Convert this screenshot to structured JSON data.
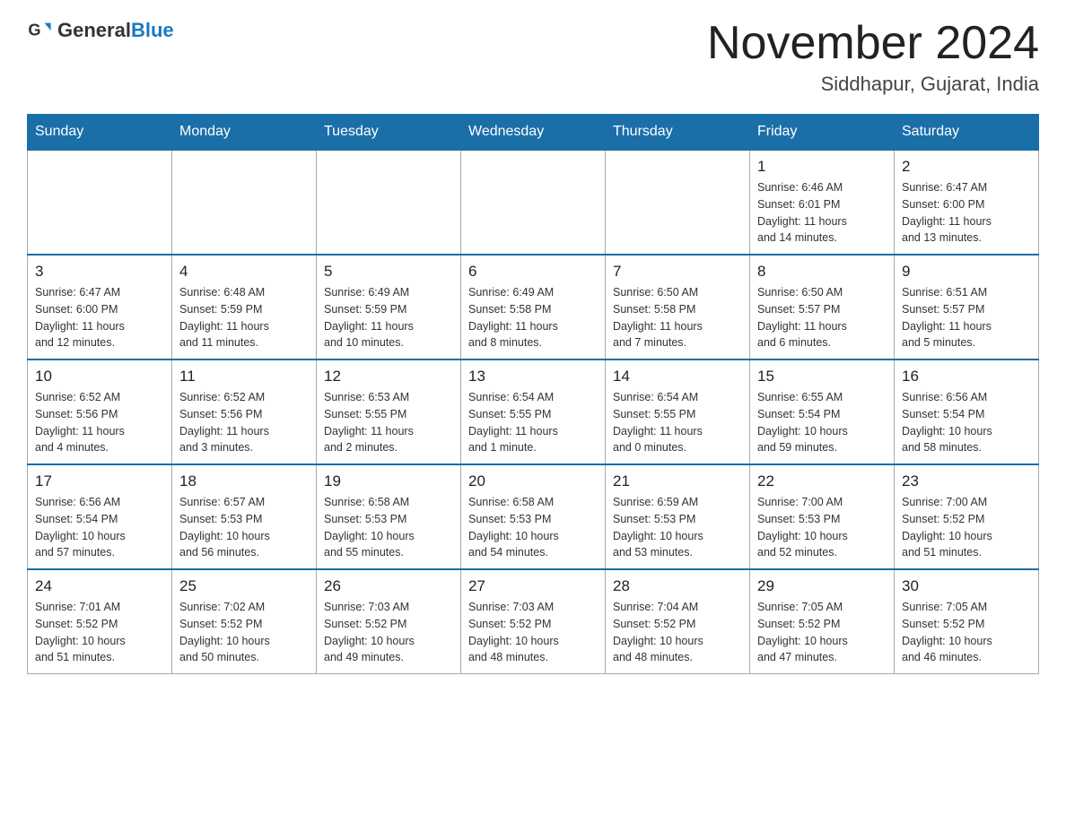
{
  "logo": {
    "general": "General",
    "blue": "Blue"
  },
  "header": {
    "month": "November 2024",
    "location": "Siddhapur, Gujarat, India"
  },
  "weekdays": [
    "Sunday",
    "Monday",
    "Tuesday",
    "Wednesday",
    "Thursday",
    "Friday",
    "Saturday"
  ],
  "weeks": [
    [
      {
        "day": "",
        "info": ""
      },
      {
        "day": "",
        "info": ""
      },
      {
        "day": "",
        "info": ""
      },
      {
        "day": "",
        "info": ""
      },
      {
        "day": "",
        "info": ""
      },
      {
        "day": "1",
        "info": "Sunrise: 6:46 AM\nSunset: 6:01 PM\nDaylight: 11 hours\nand 14 minutes."
      },
      {
        "day": "2",
        "info": "Sunrise: 6:47 AM\nSunset: 6:00 PM\nDaylight: 11 hours\nand 13 minutes."
      }
    ],
    [
      {
        "day": "3",
        "info": "Sunrise: 6:47 AM\nSunset: 6:00 PM\nDaylight: 11 hours\nand 12 minutes."
      },
      {
        "day": "4",
        "info": "Sunrise: 6:48 AM\nSunset: 5:59 PM\nDaylight: 11 hours\nand 11 minutes."
      },
      {
        "day": "5",
        "info": "Sunrise: 6:49 AM\nSunset: 5:59 PM\nDaylight: 11 hours\nand 10 minutes."
      },
      {
        "day": "6",
        "info": "Sunrise: 6:49 AM\nSunset: 5:58 PM\nDaylight: 11 hours\nand 8 minutes."
      },
      {
        "day": "7",
        "info": "Sunrise: 6:50 AM\nSunset: 5:58 PM\nDaylight: 11 hours\nand 7 minutes."
      },
      {
        "day": "8",
        "info": "Sunrise: 6:50 AM\nSunset: 5:57 PM\nDaylight: 11 hours\nand 6 minutes."
      },
      {
        "day": "9",
        "info": "Sunrise: 6:51 AM\nSunset: 5:57 PM\nDaylight: 11 hours\nand 5 minutes."
      }
    ],
    [
      {
        "day": "10",
        "info": "Sunrise: 6:52 AM\nSunset: 5:56 PM\nDaylight: 11 hours\nand 4 minutes."
      },
      {
        "day": "11",
        "info": "Sunrise: 6:52 AM\nSunset: 5:56 PM\nDaylight: 11 hours\nand 3 minutes."
      },
      {
        "day": "12",
        "info": "Sunrise: 6:53 AM\nSunset: 5:55 PM\nDaylight: 11 hours\nand 2 minutes."
      },
      {
        "day": "13",
        "info": "Sunrise: 6:54 AM\nSunset: 5:55 PM\nDaylight: 11 hours\nand 1 minute."
      },
      {
        "day": "14",
        "info": "Sunrise: 6:54 AM\nSunset: 5:55 PM\nDaylight: 11 hours\nand 0 minutes."
      },
      {
        "day": "15",
        "info": "Sunrise: 6:55 AM\nSunset: 5:54 PM\nDaylight: 10 hours\nand 59 minutes."
      },
      {
        "day": "16",
        "info": "Sunrise: 6:56 AM\nSunset: 5:54 PM\nDaylight: 10 hours\nand 58 minutes."
      }
    ],
    [
      {
        "day": "17",
        "info": "Sunrise: 6:56 AM\nSunset: 5:54 PM\nDaylight: 10 hours\nand 57 minutes."
      },
      {
        "day": "18",
        "info": "Sunrise: 6:57 AM\nSunset: 5:53 PM\nDaylight: 10 hours\nand 56 minutes."
      },
      {
        "day": "19",
        "info": "Sunrise: 6:58 AM\nSunset: 5:53 PM\nDaylight: 10 hours\nand 55 minutes."
      },
      {
        "day": "20",
        "info": "Sunrise: 6:58 AM\nSunset: 5:53 PM\nDaylight: 10 hours\nand 54 minutes."
      },
      {
        "day": "21",
        "info": "Sunrise: 6:59 AM\nSunset: 5:53 PM\nDaylight: 10 hours\nand 53 minutes."
      },
      {
        "day": "22",
        "info": "Sunrise: 7:00 AM\nSunset: 5:53 PM\nDaylight: 10 hours\nand 52 minutes."
      },
      {
        "day": "23",
        "info": "Sunrise: 7:00 AM\nSunset: 5:52 PM\nDaylight: 10 hours\nand 51 minutes."
      }
    ],
    [
      {
        "day": "24",
        "info": "Sunrise: 7:01 AM\nSunset: 5:52 PM\nDaylight: 10 hours\nand 51 minutes."
      },
      {
        "day": "25",
        "info": "Sunrise: 7:02 AM\nSunset: 5:52 PM\nDaylight: 10 hours\nand 50 minutes."
      },
      {
        "day": "26",
        "info": "Sunrise: 7:03 AM\nSunset: 5:52 PM\nDaylight: 10 hours\nand 49 minutes."
      },
      {
        "day": "27",
        "info": "Sunrise: 7:03 AM\nSunset: 5:52 PM\nDaylight: 10 hours\nand 48 minutes."
      },
      {
        "day": "28",
        "info": "Sunrise: 7:04 AM\nSunset: 5:52 PM\nDaylight: 10 hours\nand 48 minutes."
      },
      {
        "day": "29",
        "info": "Sunrise: 7:05 AM\nSunset: 5:52 PM\nDaylight: 10 hours\nand 47 minutes."
      },
      {
        "day": "30",
        "info": "Sunrise: 7:05 AM\nSunset: 5:52 PM\nDaylight: 10 hours\nand 46 minutes."
      }
    ]
  ]
}
